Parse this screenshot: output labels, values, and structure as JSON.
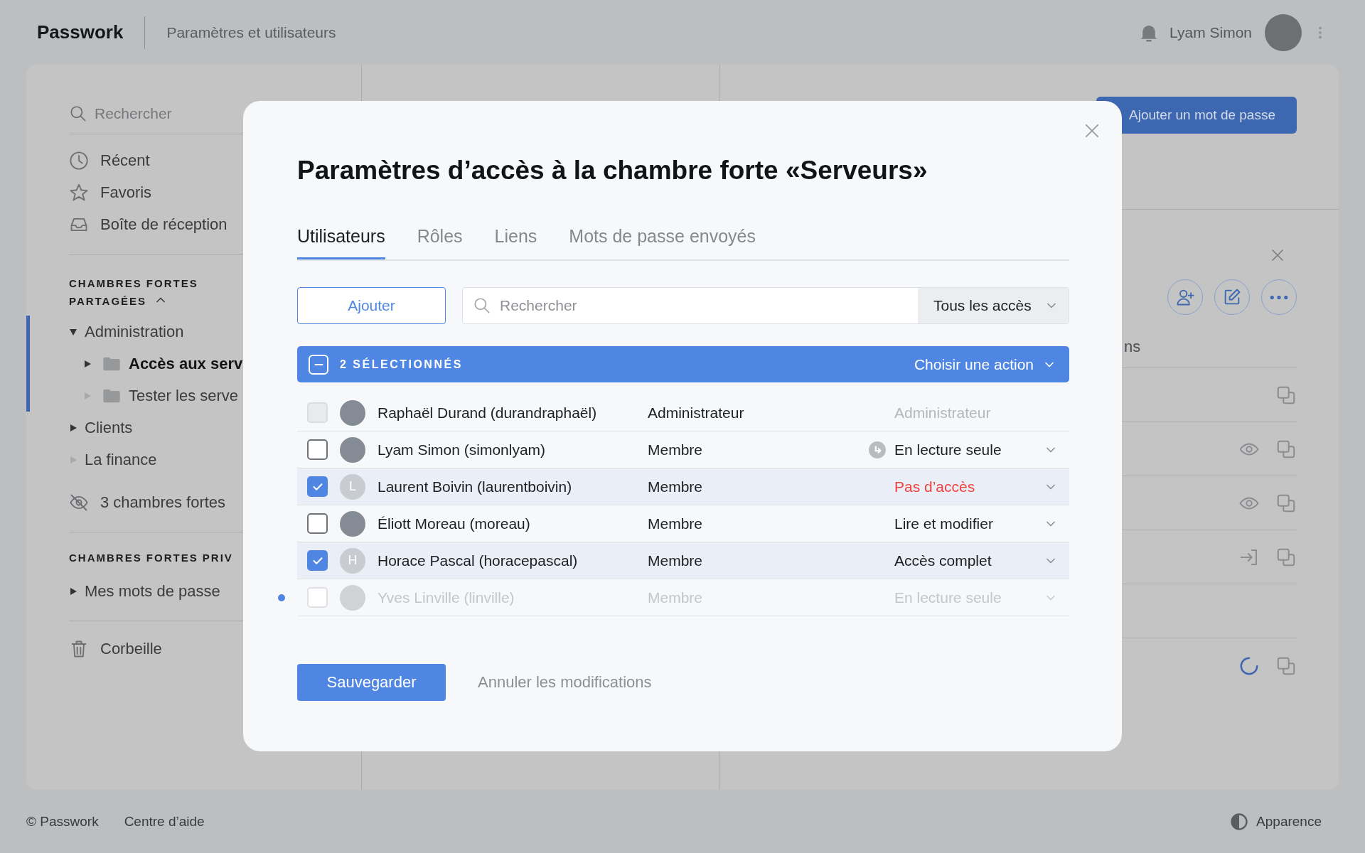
{
  "top_bar": {
    "app_name": "Passwork",
    "section": "Paramètres et utilisateurs",
    "user_name": "Lyam Simon"
  },
  "sidebar": {
    "search_placeholder": "Rechercher",
    "nav": [
      {
        "kind": "recent",
        "label": "Récent"
      },
      {
        "kind": "favorites",
        "label": "Favoris"
      },
      {
        "kind": "inbox",
        "label": "Boîte de réception"
      }
    ],
    "shared": {
      "title": "CHAMBRES FORTES PARTAGÉES",
      "expanded": true,
      "tree": [
        {
          "label": "Administration",
          "expanded": true,
          "empty": false,
          "selected": false,
          "active": true,
          "children": [
            {
              "label": "Accès aux serv",
              "expanded": false,
              "empty": false,
              "selected": true
            },
            {
              "label": "Tester les serve",
              "expanded": false,
              "empty": true,
              "selected": false
            }
          ]
        },
        {
          "label": "Clients",
          "expanded": false,
          "empty": false,
          "selected": false
        },
        {
          "label": "La finance",
          "expanded": false,
          "empty": true,
          "selected": false
        }
      ],
      "hidden": "3 chambres fortes"
    },
    "private": {
      "title": "CHAMBRES FORTES PRIV",
      "tree": [
        {
          "label": "Mes mots de passe",
          "expanded": false,
          "empty": false,
          "selected": false
        }
      ]
    },
    "trash": "Corbeille"
  },
  "right_panel": {
    "button": "Ajouter un mot de passe",
    "tab_fragment": "ns",
    "rows": [
      {
        "actions": [
          {
            "kind": "copy"
          }
        ]
      },
      {
        "actions": [
          {
            "kind": "view"
          },
          {
            "kind": "copy"
          }
        ]
      },
      {
        "actions": [
          {
            "kind": "view"
          },
          {
            "kind": "copy"
          }
        ]
      },
      {
        "actions": [
          {
            "kind": "login"
          },
          {
            "kind": "copy"
          }
        ]
      },
      {},
      {
        "actions": [
          {
            "kind": "loading"
          },
          {
            "kind": "copy"
          }
        ]
      }
    ]
  },
  "modal": {
    "title": "Paramètres d’accès à la chambre forte «Serveurs»",
    "tabs": [
      {
        "label": "Utilisateurs",
        "selected": true
      },
      {
        "label": "Rôles",
        "selected": false
      },
      {
        "label": "Liens",
        "selected": false
      },
      {
        "label": "Mots de passe envoyés",
        "selected": false
      }
    ],
    "add_button": "Ajouter",
    "search_placeholder": "Rechercher",
    "filter": "Tous les accès",
    "selection_bar": {
      "label": "2 SÉLECTIONNÉS",
      "action": "Choisir une action",
      "indeterminate": true
    },
    "users": [
      {
        "name": "Raphaël Durand (durandraphaël)",
        "role": "Administrateur",
        "access": "Administrateur",
        "avatar": {
          "kind": "photo"
        },
        "checked": false,
        "locked": true,
        "inherited": false,
        "warning": false,
        "disabled": false,
        "new": false
      },
      {
        "name": "Lyam Simon (simonlyam)",
        "role": "Membre",
        "access": "En lecture seule",
        "avatar": {
          "kind": "photo"
        },
        "checked": false,
        "locked": false,
        "inherited": true,
        "warning": false,
        "disabled": false,
        "new": false
      },
      {
        "name": "Laurent Boivin (laurentboivin)",
        "role": "Membre",
        "access": "Pas d’accès",
        "avatar": {
          "kind": "initial",
          "initial": "L"
        },
        "checked": true,
        "locked": false,
        "inherited": false,
        "warning": true,
        "disabled": false,
        "new": false
      },
      {
        "name": "Éliott Moreau (moreau)",
        "role": "Membre",
        "access": "Lire et modifier",
        "avatar": {
          "kind": "photo"
        },
        "checked": false,
        "locked": false,
        "inherited": false,
        "warning": false,
        "disabled": false,
        "new": false
      },
      {
        "name": "Horace Pascal (horacepascal)",
        "role": "Membre",
        "access": "Accès complet",
        "avatar": {
          "kind": "initial",
          "initial": "H"
        },
        "checked": true,
        "locked": false,
        "inherited": false,
        "warning": false,
        "disabled": false,
        "new": false
      },
      {
        "name": "Yves Linville (linville)",
        "role": "Membre",
        "access": "En lecture seule",
        "avatar": {
          "kind": "photo"
        },
        "checked": false,
        "locked": false,
        "inherited": false,
        "warning": false,
        "disabled": true,
        "new": true
      }
    ],
    "save": "Sauvegarder",
    "cancel": "Annuler les modifications"
  },
  "footer": {
    "copyright": "© Passwork",
    "help": "Centre d’aide",
    "appearance": "Apparence"
  }
}
